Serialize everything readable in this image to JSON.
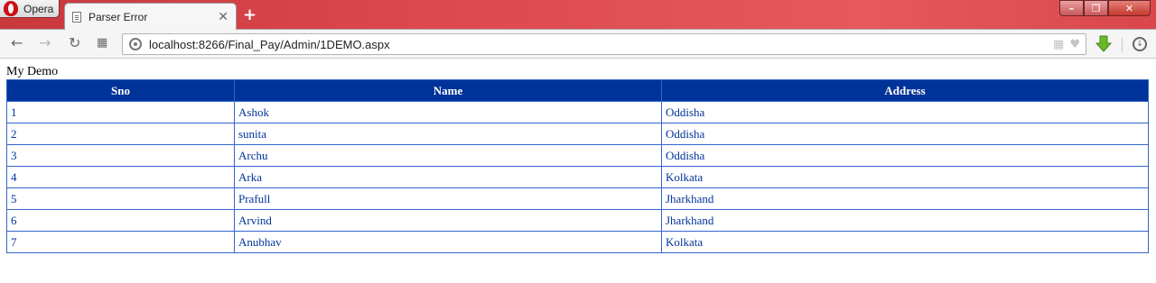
{
  "browser": {
    "menu_label": "Opera",
    "tab_title": "Parser Error",
    "tab_close": "✕",
    "new_tab": "+",
    "url": "localhost:8266/Final_Pay/Admin/1DEMO.aspx",
    "window_controls": {
      "minimize": "–",
      "maximize": "❐",
      "close": "✕"
    }
  },
  "page": {
    "heading": "My Demo",
    "table": {
      "headers": [
        "Sno",
        "Name",
        "Address"
      ],
      "rows": [
        [
          "1",
          "Ashok",
          "Oddisha"
        ],
        [
          "2",
          "sunita",
          "Oddisha"
        ],
        [
          "3",
          "Archu",
          "Oddisha"
        ],
        [
          "4",
          "Arka",
          "Kolkata"
        ],
        [
          "5",
          "Prafull",
          "Jharkhand"
        ],
        [
          "6",
          "Arvind",
          "Jharkhand"
        ],
        [
          "7",
          "Anubhav",
          "Kolkata"
        ]
      ]
    }
  },
  "colors": {
    "header_bg": "#003399",
    "header_text": "#ffffff",
    "cell_text": "#003399",
    "titlebar": "#dd4a4f"
  }
}
